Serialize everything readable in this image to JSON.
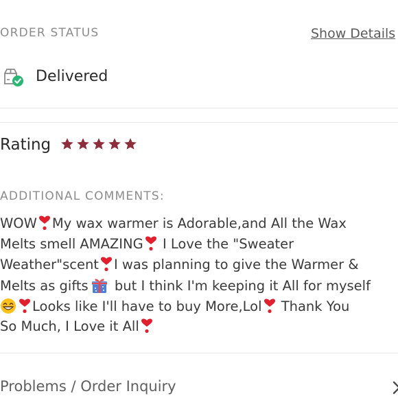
{
  "order_status": {
    "header": "ORDER STATUS",
    "show_details_link": "Show Details",
    "status_icon": "box-delivered-icon",
    "status_value": "Delivered"
  },
  "rating": {
    "label": "Rating",
    "stars_filled": 5,
    "stars_total": 5,
    "star_color": "#8e2d3b"
  },
  "comments": {
    "header": "ADDITIONAL COMMENTS:",
    "lines": {
      "l1a": "WOW",
      "l1b": "My wax warmer is Adorable,and All the Wax",
      "l2a": "Melts smell AMAZING",
      "l2b": " I Love the \"Sweater",
      "l3a": "Weather\"scent",
      "l3b": "I was planning to give the Warmer &",
      "l4a": "Melts as gifts",
      "l4b": " but I think I'm keeping it All for myself",
      "l5a": "Looks like I'll have to buy More,Lol",
      "l5b": " Thank You",
      "l6a": "So Much, I Love it All"
    },
    "emoji": {
      "heart": "red-heart-exclamation-icon",
      "gift": "wrapped-gift-icon",
      "grin": "grinning-face-icon"
    }
  },
  "inquiry": {
    "label": "Problems / Order Inquiry",
    "chevron_icon": "chevron-right-icon"
  },
  "colors": {
    "heart_red": "#e0202e",
    "check_green": "#2bb673",
    "muted_text": "#8c8c8c"
  }
}
